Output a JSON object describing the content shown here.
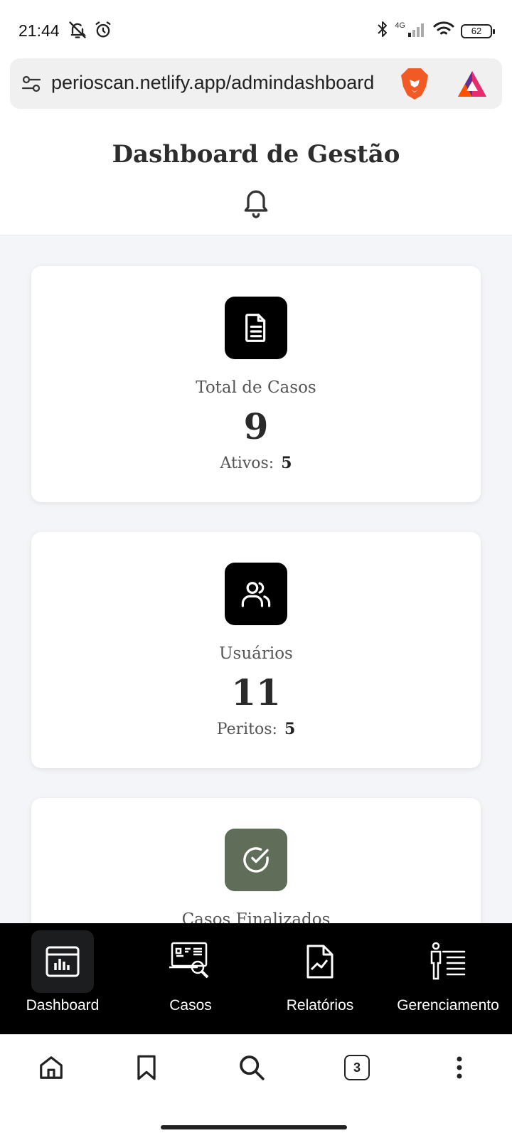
{
  "status_bar": {
    "time": "21:44",
    "network": "4G",
    "battery": "62",
    "icons": [
      "muted-bell-icon",
      "alarm-icon",
      "bluetooth-icon",
      "signal-icon",
      "wifi-icon",
      "battery-icon"
    ]
  },
  "browser": {
    "url": "perioscan.netlify.app/admindashboard",
    "tab_count": "3",
    "toolbar_icons": [
      "home-icon",
      "bookmark-icon",
      "search-icon",
      "tabs-icon",
      "more-icon"
    ]
  },
  "header": {
    "title": "Dashboard de Gestão"
  },
  "cards": [
    {
      "label": "Total de Casos",
      "value": "9",
      "sub_label": "Ativos:",
      "sub_value": "5",
      "icon": "document-icon"
    },
    {
      "label": "Usuários",
      "value": "11",
      "sub_label": "Peritos:",
      "sub_value": "5",
      "icon": "users-icon"
    },
    {
      "label": "Casos Finalizados",
      "icon": "check-circle-icon"
    }
  ],
  "nav": {
    "items": [
      {
        "label": "Dashboard",
        "icon": "dashboard-icon",
        "active": true
      },
      {
        "label": "Casos",
        "icon": "case-search-icon"
      },
      {
        "label": "Relatórios",
        "icon": "report-icon"
      },
      {
        "label": "Gerenciamento",
        "icon": "management-icon"
      }
    ]
  },
  "colors": {
    "accent_black": "#000000",
    "accent_green": "#5f6d59",
    "content_bg": "#f4f5f8"
  }
}
